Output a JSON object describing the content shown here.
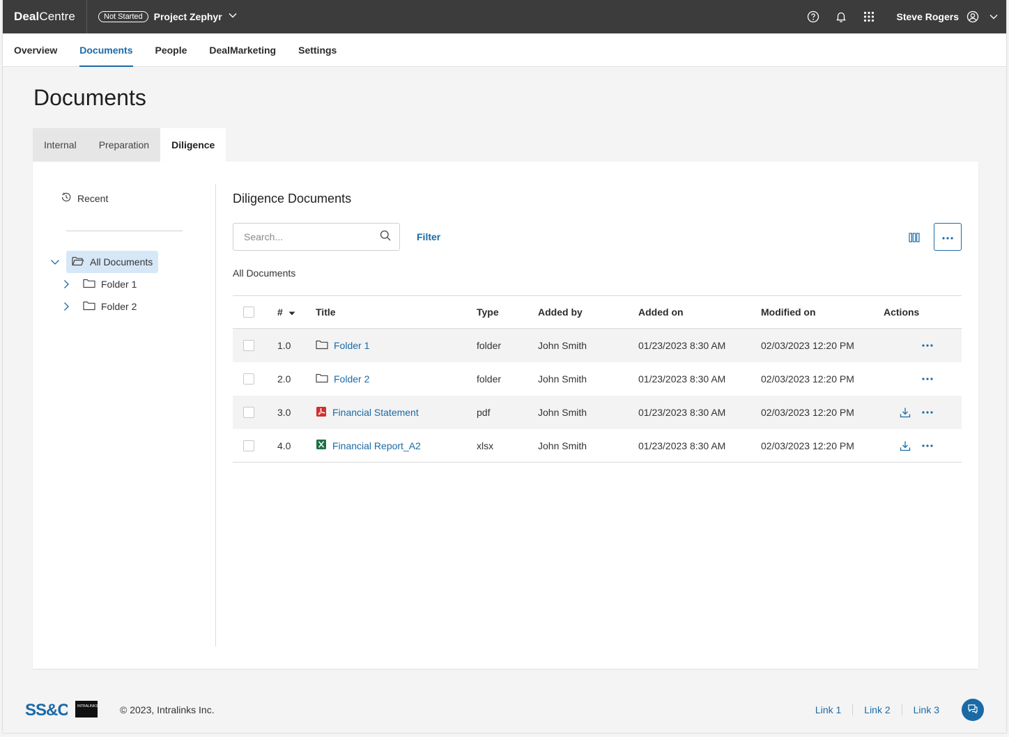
{
  "app": {
    "brand_bold": "Deal",
    "brand_rest": "Centre",
    "project_status": "Not Started",
    "project_name": "Project Zephyr",
    "user_name": "Steve Rogers"
  },
  "nav": {
    "items": [
      "Overview",
      "Documents",
      "People",
      "DealMarketing",
      "Settings"
    ],
    "active": "Documents"
  },
  "page": {
    "title": "Documents"
  },
  "doc_tabs": {
    "items": [
      "Internal",
      "Preparation",
      "Diligence"
    ],
    "active": "Diligence"
  },
  "sidebar": {
    "recent_label": "Recent",
    "tree": {
      "root": "All Documents",
      "children": [
        "Folder 1",
        "Folder 2"
      ]
    }
  },
  "content": {
    "title": "Diligence Documents",
    "search_placeholder": "Search...",
    "filter_label": "Filter",
    "breadcrumb": "All Documents"
  },
  "table": {
    "headers": {
      "num": "#",
      "title": "Title",
      "type": "Type",
      "added_by": "Added by",
      "added_on": "Added on",
      "modified_on": "Modified on",
      "actions": "Actions"
    },
    "rows": [
      {
        "num": "1.0",
        "title": "Folder 1",
        "icon": "folder-icon",
        "type": "folder",
        "added_by": "John Smith",
        "added_on": "01/23/2023 8:30 AM",
        "modified_on": "02/03/2023 12:20 PM",
        "download": false
      },
      {
        "num": "2.0",
        "title": "Folder 2",
        "icon": "folder-icon",
        "type": "folder",
        "added_by": "John Smith",
        "added_on": "01/23/2023 8:30 AM",
        "modified_on": "02/03/2023 12:20 PM",
        "download": false
      },
      {
        "num": "3.0",
        "title": "Financial Statement",
        "icon": "pdf-icon",
        "type": "pdf",
        "added_by": "John Smith",
        "added_on": "01/23/2023 8:30 AM",
        "modified_on": "02/03/2023 12:20 PM",
        "download": true
      },
      {
        "num": "4.0",
        "title": "Financial Report_A2",
        "icon": "excel-icon",
        "type": "xlsx",
        "added_by": "John Smith",
        "added_on": "01/23/2023 8:30 AM",
        "modified_on": "02/03/2023 12:20 PM",
        "download": true
      }
    ]
  },
  "footer": {
    "ssc_logo": "SS&C",
    "intralinks_logo": "INTRALINKS",
    "copyright": "© 2023, Intralinks Inc.",
    "links": [
      "Link 1",
      "Link 2",
      "Link 3"
    ]
  },
  "colors": {
    "accent": "#1a6aa6",
    "topbar": "#3c3c3c",
    "pdf": "#d0312d",
    "excel": "#1e7145",
    "selected_bg": "#d6e8f7"
  }
}
